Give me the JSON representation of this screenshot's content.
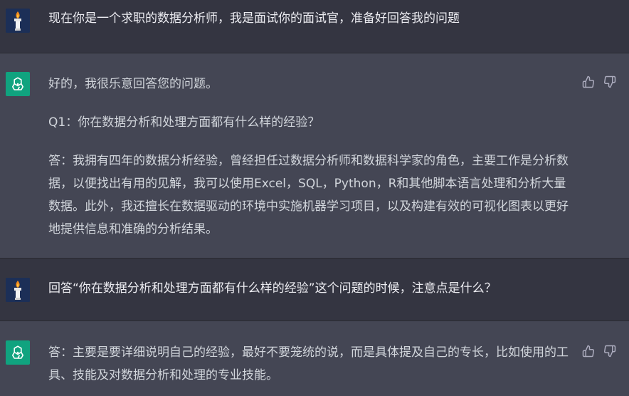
{
  "messages": [
    {
      "role": "user",
      "text": "现在你是一个求职的数据分析师，我是面试你的面试官，准备好回答我的问题"
    },
    {
      "role": "assistant",
      "paragraphs": [
        "好的，我很乐意回答您的问题。",
        "Q1：你在数据分析和处理方面都有什么样的经验？",
        "答：我拥有四年的数据分析经验，曾经担任过数据分析师和数据科学家的角色，主要工作是分析数据，以便找出有用的见解，我可以使用Excel，SQL，Python，R和其他脚本语言处理和分析大量数据。此外，我还擅长在数据驱动的环境中实施机器学习项目，以及构建有效的可视化图表以更好地提供信息和准确的分析结果。"
      ]
    },
    {
      "role": "user",
      "text": "回答“你在数据分析和处理方面都有什么样的经验”这个问题的时候，注意点是什么？"
    },
    {
      "role": "assistant",
      "paragraphs": [
        "答：主要是要详细说明自己的经验，最好不要笼统的说，而是具体提及自己的专长，比如使用的工具、技能及对数据分析和处理的专业技能。"
      ]
    }
  ],
  "icons": {
    "user_avatar": "torch-avatar-icon",
    "assistant_avatar": "openai-logo-icon",
    "like": "thumbs-up-icon",
    "dislike": "thumbs-down-icon"
  },
  "colors": {
    "user_bg": "#343541",
    "assistant_bg": "#444654",
    "assistant_avatar": "#10a37f",
    "user_avatar": "#1c2f57"
  }
}
